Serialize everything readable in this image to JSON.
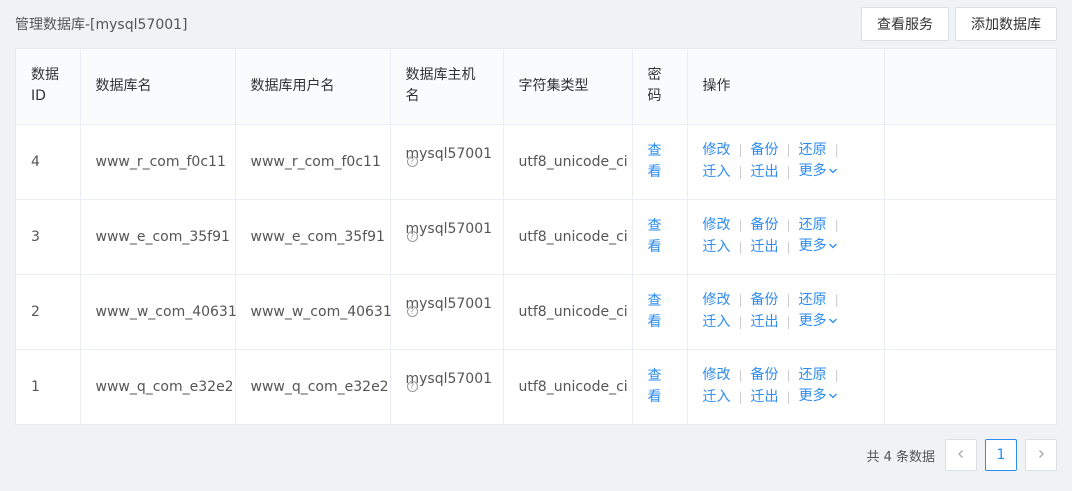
{
  "page": {
    "title": "管理数据库-[mysql57001]"
  },
  "toolbar": {
    "view_service": "查看服务",
    "add_database": "添加数据库"
  },
  "table": {
    "headers": {
      "id": "数据ID",
      "db_name": "数据库名",
      "db_user": "数据库用户名",
      "db_host": "数据库主机名",
      "charset": "字符集类型",
      "password": "密码",
      "actions": "操作"
    },
    "rows": [
      {
        "id": "4",
        "db_name": "www_r_com_f0c11",
        "db_user": "www_r_com_f0c11",
        "db_host": "mysql57001",
        "charset": "utf8_unicode_ci"
      },
      {
        "id": "3",
        "db_name": "www_e_com_35f91",
        "db_user": "www_e_com_35f91",
        "db_host": "mysql57001",
        "charset": "utf8_unicode_ci"
      },
      {
        "id": "2",
        "db_name": "www_w_com_40631",
        "db_user": "www_w_com_40631",
        "db_host": "mysql57001",
        "charset": "utf8_unicode_ci"
      },
      {
        "id": "1",
        "db_name": "www_q_com_e32e2",
        "db_user": "www_q_com_e32e2",
        "db_host": "mysql57001",
        "charset": "utf8_unicode_ci"
      }
    ],
    "labels": {
      "view_password": "查看",
      "modify": "修改",
      "backup": "备份",
      "restore": "还原",
      "migrate_in": "迁入",
      "migrate_out": "迁出",
      "more": "更多",
      "host_help": "?"
    }
  },
  "pagination": {
    "total_text": "共 4 条数据",
    "current_page": "1",
    "prev_icon": "chevron-left-icon",
    "next_icon": "chevron-right-icon"
  },
  "colors": {
    "link": "#2d8cf0",
    "background": "#f0f2f5",
    "header_bg": "#fafbfc"
  }
}
